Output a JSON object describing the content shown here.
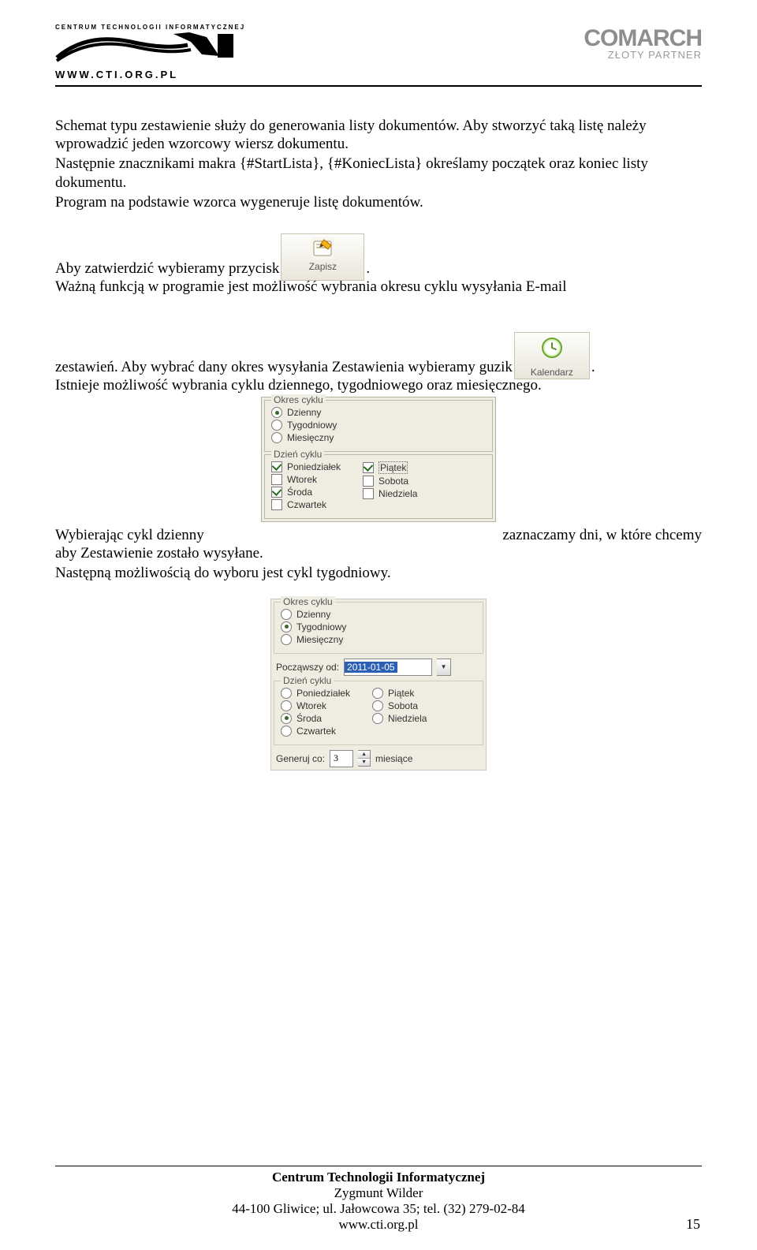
{
  "header": {
    "tagline": "CENTRUM TECHNOLOGII INFORMATYCZNEJ",
    "url": "WWW.CTI.ORG.PL",
    "partner_brand": "COMARCH",
    "partner_level": "ZŁOTY PARTNER"
  },
  "body": {
    "p1": "Schemat typu zestawienie służy do generowania listy dokumentów. Aby stworzyć taką listę należy wprowadzić jeden wzorcowy wiersz dokumentu.",
    "p2": "Następnie znacznikami makra {#StartLista}, {#KoniecLista} określamy początek oraz koniec listy dokumentu.",
    "p3": "Program na podstawie wzorca wygeneruje listę dokumentów.",
    "p4_pre": " Aby zatwierdzić wybieramy przycisk ",
    "p4_post": ".",
    "zapisz_label": "Zapisz",
    "p5": "Ważną funkcją w programie jest możliwość wybrania okresu cyklu wysyłania E-mail",
    "p6_pre": "zestawień. Aby wybrać dany okres wysyłania Zestawienia wybieramy guzik ",
    "p6_post": ".",
    "kalendarz_label": "Kalendarz",
    "p7": "Istnieje możliwość wybrania cyklu dziennego, tygodniowego oraz miesięcznego.",
    "p8_pre": "Wybierając cykl dzienny ",
    "p8_post": " zaznaczamy dni, w które chcemy",
    "p8_line2": "aby Zestawienie zostało wysyłane.",
    "p9": "Następną możliwością do wyboru jest cykl tygodniowy."
  },
  "dlg1": {
    "okres_legend": "Okres cyklu",
    "opts": [
      "Dzienny",
      "Tygodniowy",
      "Miesięczny"
    ],
    "dzien_legend": "Dzień cyklu",
    "days_l": [
      "Poniedziałek",
      "Wtorek",
      "Środa",
      "Czwartek"
    ],
    "days_r": [
      "Piątek",
      "Sobota",
      "Niedziela"
    ]
  },
  "dlg2": {
    "okres_legend": "Okres cyklu",
    "opts": [
      "Dzienny",
      "Tygodniowy",
      "Miesięczny"
    ],
    "start_label": "Począwszy od:",
    "start_value": "2011-01-05",
    "dzien_legend": "Dzień cyklu",
    "days_l": [
      "Poniedziałek",
      "Wtorek",
      "Środa",
      "Czwartek"
    ],
    "days_r": [
      "Piątek",
      "Sobota",
      "Niedziela"
    ],
    "gen_label": "Generuj co:",
    "gen_value": "3",
    "gen_unit": "miesiące"
  },
  "footer": {
    "l1": "Centrum Technologii Informatycznej",
    "l2": "Zygmunt Wilder",
    "l3": "44-100 Gliwice; ul. Jałowcowa 35; tel. (32) 279-02-84",
    "l4": "www.cti.org.pl",
    "page": "15"
  }
}
